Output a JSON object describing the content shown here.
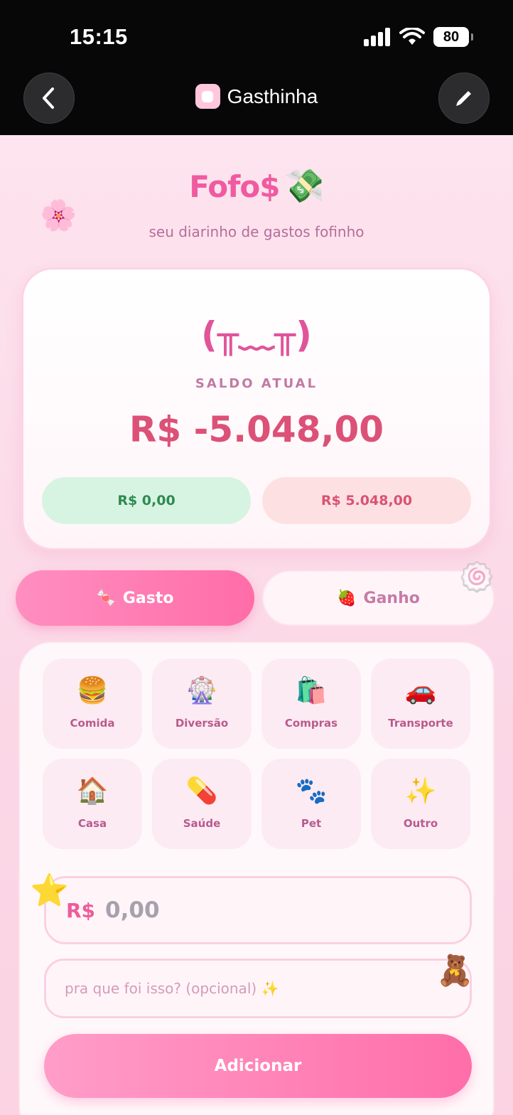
{
  "status_bar": {
    "time": "15:15",
    "battery": "80"
  },
  "nav": {
    "title": "Gasthinha"
  },
  "header": {
    "brand": "Fofo$",
    "brand_emoji": "💸",
    "subtitle": "seu diarinho de gastos fofinho"
  },
  "balance": {
    "kaomoji": "(╥﹏╥)",
    "label": "SALDO ATUAL",
    "value": "R$ -5.048,00",
    "income": "R$ 0,00",
    "expense": "R$ 5.048,00"
  },
  "tabs": {
    "gasto": {
      "emoji": "🍬",
      "label": "Gasto"
    },
    "ganho": {
      "emoji": "🍓",
      "label": "Ganho"
    }
  },
  "categories": [
    {
      "emoji": "🍔",
      "label": "Comida"
    },
    {
      "emoji": "🎡",
      "label": "Diversão"
    },
    {
      "emoji": "🛍️",
      "label": "Compras"
    },
    {
      "emoji": "🚗",
      "label": "Transporte"
    },
    {
      "emoji": "🏠",
      "label": "Casa"
    },
    {
      "emoji": "💊",
      "label": "Saúde"
    },
    {
      "emoji": "🐾",
      "label": "Pet"
    },
    {
      "emoji": "✨",
      "label": "Outro"
    }
  ],
  "form": {
    "currency_prefix": "R$",
    "amount_placeholder": "0,00",
    "note_placeholder": "pra que foi isso? (opcional) ✨",
    "submit_label": "Adicionar"
  },
  "decorations": {
    "flower": "🌸",
    "candy": "🍥",
    "star": "⭐",
    "bear": "🧸"
  },
  "colors": {
    "accent": "#ff6da8",
    "brand": "#f05aa0",
    "balance_negative": "#dc5177",
    "income": "#2e8a52",
    "expense": "#da5273"
  }
}
